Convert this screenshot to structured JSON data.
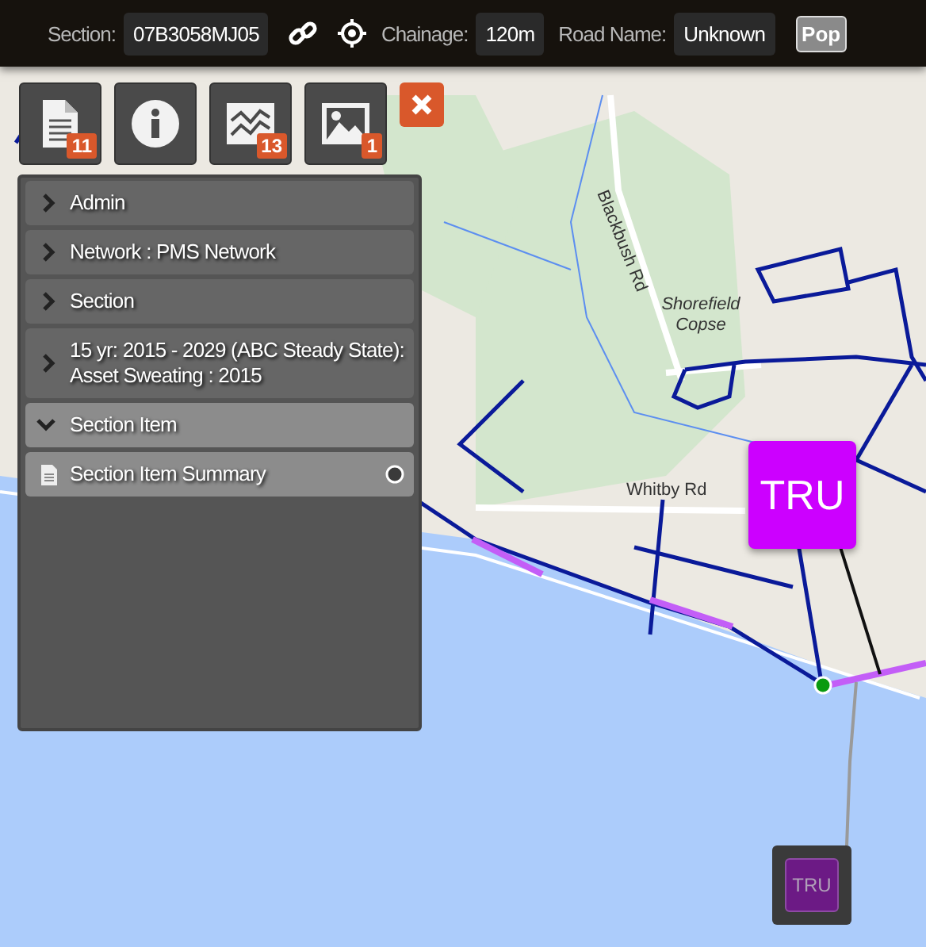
{
  "top_bar": {
    "section_label": "Section:",
    "section_value": "07B3058MJ05",
    "chainage_label": "Chainage:",
    "chainage_value": "120m",
    "road_name_label": "Road Name:",
    "road_name_value": "Unknown",
    "pop_button": "Pop"
  },
  "toolbar": [
    {
      "kind": "document",
      "badge": "11"
    },
    {
      "kind": "info"
    },
    {
      "kind": "chart",
      "badge": "13"
    },
    {
      "kind": "image",
      "badge": "1"
    }
  ],
  "panel": {
    "items": [
      {
        "label": "Admin",
        "expanded": false
      },
      {
        "label": "Network : PMS Network",
        "expanded": false
      },
      {
        "label": "Section",
        "expanded": false
      },
      {
        "label": "15 yr: 2015 - 2029 (ABC Steady State): Asset Sweating : 2015",
        "expanded": false
      },
      {
        "label": "Section Item",
        "expanded": true,
        "children": [
          {
            "label": "Section Item Summary"
          }
        ]
      }
    ]
  },
  "map": {
    "labels": [
      {
        "text": "Blackbush Rd",
        "kind": "road"
      },
      {
        "text": "Shorefield Copse",
        "kind": "area"
      },
      {
        "text": "Whitby Rd",
        "kind": "road"
      }
    ],
    "markers": [
      {
        "label": "TRU",
        "kind": "large"
      },
      {
        "label": "TRU",
        "kind": "small"
      }
    ]
  }
}
